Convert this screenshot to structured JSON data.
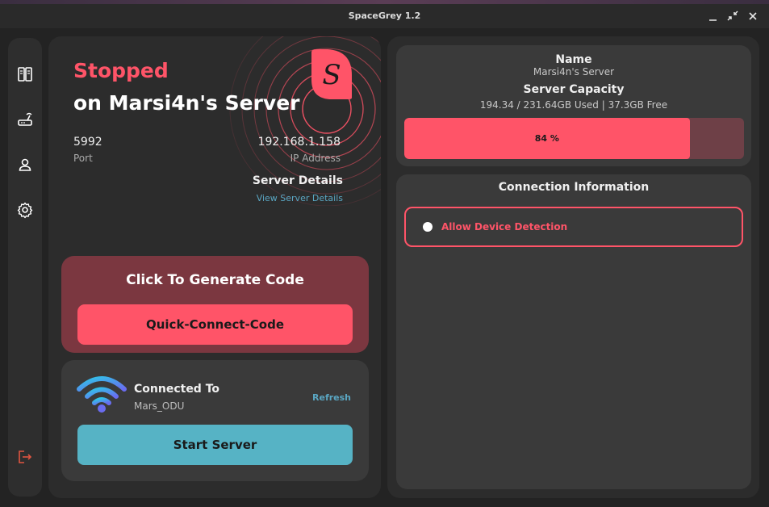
{
  "window": {
    "title": "SpaceGrey 1.2"
  },
  "window_controls": [
    "minimize-icon",
    "restore-icon",
    "close-icon"
  ],
  "sidebar": {
    "items": [
      {
        "icon": "book-icon"
      },
      {
        "icon": "router-icon"
      },
      {
        "icon": "user-icon"
      },
      {
        "icon": "gear-icon"
      }
    ],
    "footer_icon": "logout-icon"
  },
  "server": {
    "status": "Stopped",
    "name_line": "on Marsi4n's Server",
    "port_value": "5992",
    "port_label": "Port",
    "ip_value": "192.168.1.158",
    "ip_label": "IP Address",
    "details_title": "Server Details",
    "details_link": "View Server Details",
    "logo_letter": "S"
  },
  "generate": {
    "title": "Click To Generate Code",
    "button": "Quick-Connect-Code"
  },
  "connection": {
    "title": "Connected To",
    "network": "Mars_ODU",
    "refresh": "Refresh",
    "start_button": "Start Server"
  },
  "info": {
    "name_title": "Name",
    "name_value": "Marsi4n's Server",
    "capacity_title": "Server Capacity",
    "capacity_value": "194.34 / 231.64GB Used | 37.3GB Free",
    "capacity_percent": 84,
    "capacity_label": "84 %"
  },
  "connection_info": {
    "title": "Connection Information",
    "toggle_label": "Allow Device Detection",
    "toggle_on": false
  },
  "colors": {
    "accent": "#ff5468",
    "link": "#5aa6c2",
    "start_button": "#56b3c5",
    "panel": "#2c2c2c",
    "card": "#3a3a3a"
  }
}
